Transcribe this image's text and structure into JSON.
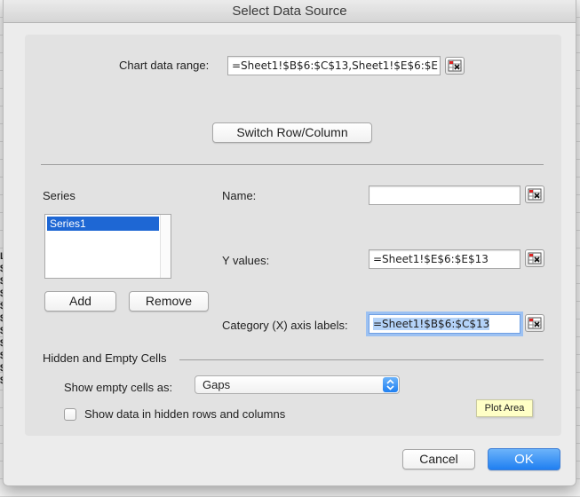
{
  "dialog": {
    "title": "Select Data Source",
    "chart_range_label": "Chart data range:",
    "chart_range_value": "=Sheet1!$B$6:$C$13,Sheet1!$E$6:$E",
    "switch_button": "Switch Row/Column",
    "series_header": "Series",
    "series_items": [
      "Series1"
    ],
    "name_label": "Name:",
    "name_value": "",
    "y_values_label": "Y values:",
    "y_values_value": "=Sheet1!$E$6:$E$13",
    "category_label": "Category (X) axis labels:",
    "category_value": "=Sheet1!$B$6:$C$13",
    "add_button": "Add",
    "remove_button": "Remove",
    "hidden_section": "Hidden and Empty Cells",
    "show_empty_label": "Show empty cells as:",
    "show_empty_value": "Gaps",
    "hidden_rows_label": "Show data in hidden rows and columns",
    "hidden_rows_checked": false,
    "tooltip": "Plot Area",
    "cancel_button": "Cancel",
    "ok_button": "OK"
  },
  "background": {
    "column_glyphs": [
      "L",
      "$",
      "$",
      "$",
      "$",
      "$",
      "$",
      "$",
      "$",
      "$",
      "$"
    ]
  },
  "colors": {
    "accent": "#1f7ff1",
    "selection": "#1e67d4",
    "tooltip_bg": "#ffffc6"
  },
  "icons": {
    "range_picker": "range-selector-icon",
    "popup": "updown-chevron-icon"
  }
}
